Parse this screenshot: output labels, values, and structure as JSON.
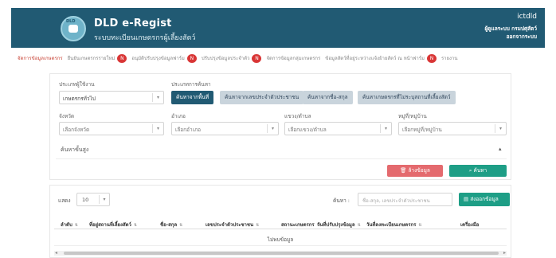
{
  "header": {
    "logo_text": "DLD",
    "app_title": "DLD e-Regist",
    "app_subtitle": "ระบบทะเบียนเกษตรกรผู้เลี้ยงสัตว์",
    "username": "ictdld",
    "role": "ผู้ดูแลระบบ กรมปศุสัตว์",
    "org": "ออกจากระบบ"
  },
  "nav": {
    "items": [
      {
        "label": "จัดการข้อมูลเกษตรกร",
        "badge": ""
      },
      {
        "label": "ยืนยันเกษตรกรรายใหม่",
        "badge": "N"
      },
      {
        "label": "อนุมัติปรับปรุงข้อมูลฟาร์ม",
        "badge": "N"
      },
      {
        "label": "ปรับปรุงข้อมูลประจำตัว",
        "badge": "N"
      },
      {
        "label": "จัดการข้อมูลกลุ่มเกษตรกร",
        "badge": ""
      },
      {
        "label": "ข้อมูลสัตว์ที่อยู่ระหว่างแจ้งย้ายสัตว์ ณ หน้าฟาร์ม",
        "badge": "N"
      },
      {
        "label": "รายงาน",
        "badge": ""
      }
    ]
  },
  "filters": {
    "type_label": "ประเภทผู้ใช้งาน",
    "type_value": "เกษตรกรทั่วไป",
    "search_type_label": "ประเภทการค้นหา",
    "chips": [
      "ค้นหาจากพื้นที่",
      "ค้นหาจากเลขประจำตัวประชาชน",
      "ค้นหาจากชื่อ-สกุล",
      "ค้นหาเกษตรกรที่ไม่ระบุสถานที่เลี้ยงสัตว์"
    ],
    "province_label": "จังหวัด",
    "province_placeholder": "เลือกจังหวัด",
    "district_label": "อำเภอ",
    "district_placeholder": "เลือกอำเภอ",
    "subdistrict_label": "แขวง/ตำบล",
    "subdistrict_placeholder": "เลือกแขวง/ตำบล",
    "village_label": "หมู่ที่/หมู่บ้าน",
    "village_placeholder": "เลือกหมู่ที่/หมู่บ้าน",
    "advanced_label": "ค้นหาขั้นสูง",
    "clear_label": "ล้างข้อมูล",
    "search_label": "ค้นหา"
  },
  "table": {
    "show_label": "แสดง",
    "page_size": "10",
    "find_label": "ค้นหา :",
    "find_placeholder": "ชื่อ-สกุล, เลขประจำตัวประชาชน",
    "export_label": "ส่งออกข้อมูล",
    "columns": [
      "ลำดับ",
      "ที่อยู่สถานที่เลี้ยงสัตว์",
      "ชื่อ-สกุล",
      "เลขประจำตัวประชาชน",
      "สถานะเกษตรกร",
      "วันที่ปรับปรุงข้อมูล",
      "วันที่ลงทะเบียนเกษตรกร",
      "เครื่องมือ"
    ],
    "empty_text": "ไม่พบข้อมูล"
  }
}
